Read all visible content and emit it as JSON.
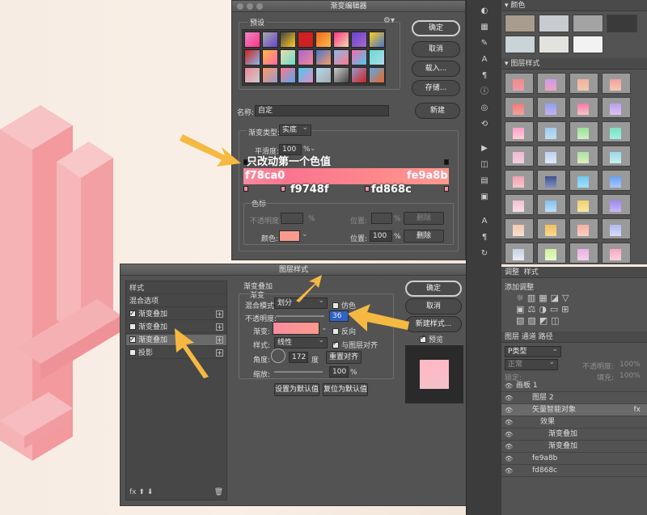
{
  "gradient_editor": {
    "title": "渐变编辑器",
    "presets_label": "预设",
    "buttons": {
      "ok": "确定",
      "cancel": "取消",
      "load": "载入...",
      "save": "存储...",
      "new": "新建"
    },
    "name_label": "名称:",
    "name_value": "自定",
    "type_label": "渐变类型:",
    "type_value": "实底",
    "smoothness_label": "平滑度:",
    "smoothness_value": "100",
    "smoothness_unit": "%",
    "stops_label": "色标",
    "opacity_label": "不透明度:",
    "opacity_unit": "%",
    "location_label": "位置:",
    "location_unit": "%",
    "delete_label": "删除",
    "color_label": "颜色:",
    "location_value": "100",
    "delete_label2": "删除",
    "preset_colors": [
      "#e78ac3",
      "#aaaaaa",
      "#444444",
      "#cc2222",
      "#ee6622",
      "#ff3388",
      "#6644cc",
      "#ffcc22",
      "#d02020",
      "#ffbb44",
      "#eeddaa",
      "#aa66cc",
      "#4477cc",
      "#88bbee",
      "#ff66aa",
      "#66ddcc",
      "#ee8899",
      "#ff9966",
      "#ff7788",
      "#44ccee",
      "#b0d8f0",
      "#cccccc",
      "#9999cc",
      "#55aaee"
    ]
  },
  "annotations": {
    "note": "只改动第一个色值",
    "hex_left": "f78ca0",
    "hex_right": "fe9a8b",
    "hex_mid1": "f9748f",
    "hex_mid2": "fd868c"
  },
  "layer_style": {
    "title": "图层样式",
    "left_items": [
      {
        "label": "样式",
        "checked": null
      },
      {
        "label": "混合选项",
        "checked": null
      },
      {
        "label": "渐变叠加",
        "checked": true
      },
      {
        "label": "渐变叠加",
        "checked": false
      },
      {
        "label": "渐变叠加",
        "checked": true
      },
      {
        "label": "投影",
        "checked": false
      }
    ],
    "section_title": "渐变叠加",
    "subsection": "渐变",
    "blend_label": "混合模式:",
    "blend_value": "划分",
    "dither_label": "仿色",
    "opacity_label": "不透明度:",
    "opacity_value": "36",
    "reverse_label": "反向",
    "gradient_label": "渐变:",
    "style_label": "样式:",
    "style_value": "线性",
    "align_label": "与图层对齐",
    "angle_label": "角度:",
    "angle_value": "172",
    "angle_unit": "度",
    "reset_align": "重置对齐",
    "scale_label": "缩放:",
    "scale_value": "100",
    "scale_unit": "%",
    "set_default": "设置为默认值",
    "reset_default": "复位为默认值",
    "buttons": {
      "ok": "确定",
      "cancel": "取消",
      "new_style": "新建样式...",
      "preview": "预览"
    }
  },
  "panels": {
    "swatches_title": "颜色",
    "styles_title": "图层样式",
    "adjust_tabs": [
      "调整",
      "样式"
    ],
    "adjust_add": "添加调整",
    "layers_tabs": [
      "图层",
      "通道",
      "路径"
    ],
    "kind_filter": "P类型",
    "blend_normal": "正常",
    "opacity_label": "不透明度:",
    "opacity_value": "100%",
    "lock_label": "锁定:",
    "fill_label": "填充:",
    "fill_value": "100%",
    "layers": [
      {
        "name": "画板 1",
        "indent": 0
      },
      {
        "name": "图层 2",
        "indent": 2
      },
      {
        "name": "矢量智能对象",
        "indent": 2
      },
      {
        "name": "效果",
        "indent": 3
      },
      {
        "name": "渐变叠加",
        "indent": 4
      },
      {
        "name": "渐变叠加",
        "indent": 4
      },
      {
        "name": "fe9a8b",
        "indent": 2
      },
      {
        "name": "fd868c",
        "indent": 2
      }
    ],
    "fx_label": "fx"
  },
  "colors": {
    "g1": "#f78ca0",
    "g2": "#f9748f",
    "g3": "#fd868c",
    "g4": "#fe9a8b",
    "annotation_arrow": "#f5b942"
  }
}
